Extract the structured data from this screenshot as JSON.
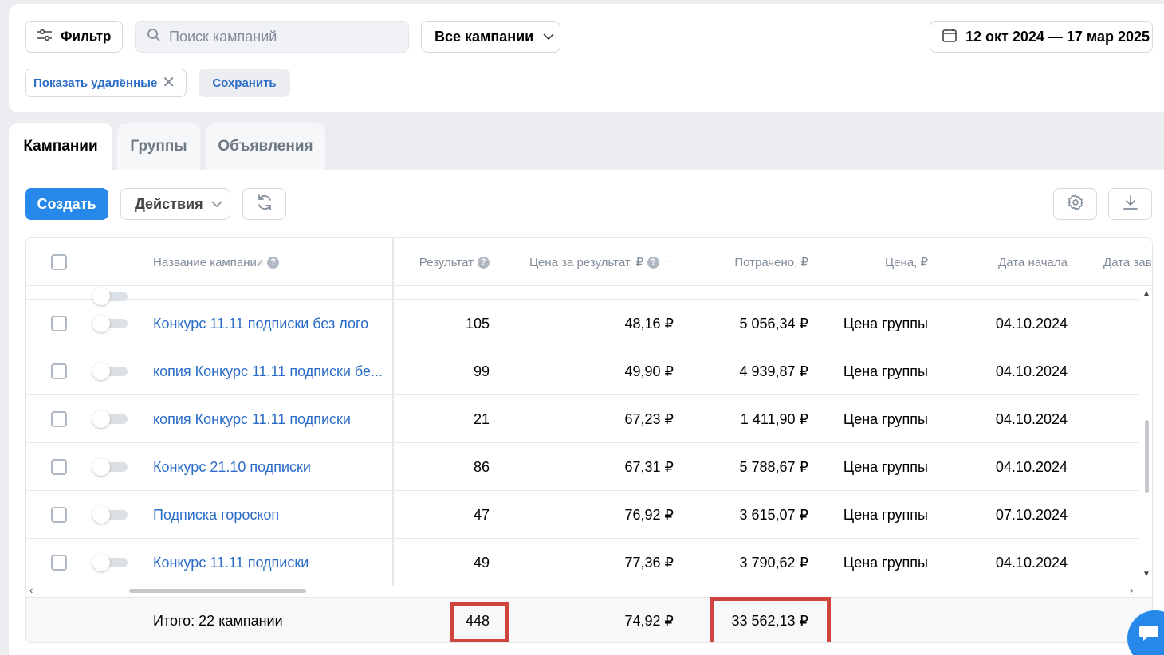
{
  "filters": {
    "filter_label": "Фильтр",
    "search_placeholder": "Поиск кампаний",
    "campaigns_select": "Все кампании",
    "date_range": "12 окт 2024 — 17 мар 2025",
    "chip_deleted": "Показать удалённые",
    "chip_save": "Сохранить"
  },
  "tabs": [
    {
      "label": "Кампании"
    },
    {
      "label": "Группы"
    },
    {
      "label": "Объявления"
    }
  ],
  "toolbar": {
    "create_label": "Создать",
    "actions_label": "Действия"
  },
  "table": {
    "columns": {
      "name": "Название кампании",
      "result": "Результат",
      "price_result": "Цена за результат, ₽",
      "spent": "Потрачено, ₽",
      "price": "Цена, ₽",
      "start_date": "Дата начала",
      "end_date": "Дата зав"
    },
    "rows": [
      {
        "name": "Конкурс 11.11 подписки без лого",
        "result": "105",
        "price_result": "48,16 ₽",
        "spent": "5 056,34 ₽",
        "price": "Цена группы",
        "start_date": "04.10.2024"
      },
      {
        "name": "копия Конкурс 11.11 подписки бе...",
        "result": "99",
        "price_result": "49,90 ₽",
        "spent": "4 939,87 ₽",
        "price": "Цена группы",
        "start_date": "04.10.2024"
      },
      {
        "name": "копия Конкурс 11.11 подписки",
        "result": "21",
        "price_result": "67,23 ₽",
        "spent": "1 411,90 ₽",
        "price": "Цена группы",
        "start_date": "04.10.2024"
      },
      {
        "name": "Конкурс 21.10 подписки",
        "result": "86",
        "price_result": "67,31 ₽",
        "spent": "5 788,67 ₽",
        "price": "Цена группы",
        "start_date": "04.10.2024"
      },
      {
        "name": "Подписка гороскоп",
        "result": "47",
        "price_result": "76,92 ₽",
        "spent": "3 615,07 ₽",
        "price": "Цена группы",
        "start_date": "07.10.2024"
      },
      {
        "name": "Конкурс 11.11 подписки",
        "result": "49",
        "price_result": "77,36 ₽",
        "spent": "3 790,62 ₽",
        "price": "Цена группы",
        "start_date": "04.10.2024"
      }
    ],
    "totals": {
      "label": "Итого: 22 кампании",
      "result": "448",
      "price_result": "74,92 ₽",
      "spent": "33 562,13 ₽"
    }
  },
  "colors": {
    "accent": "#2688eb",
    "link": "#2a6cc7",
    "highlight": "#d0443e"
  }
}
